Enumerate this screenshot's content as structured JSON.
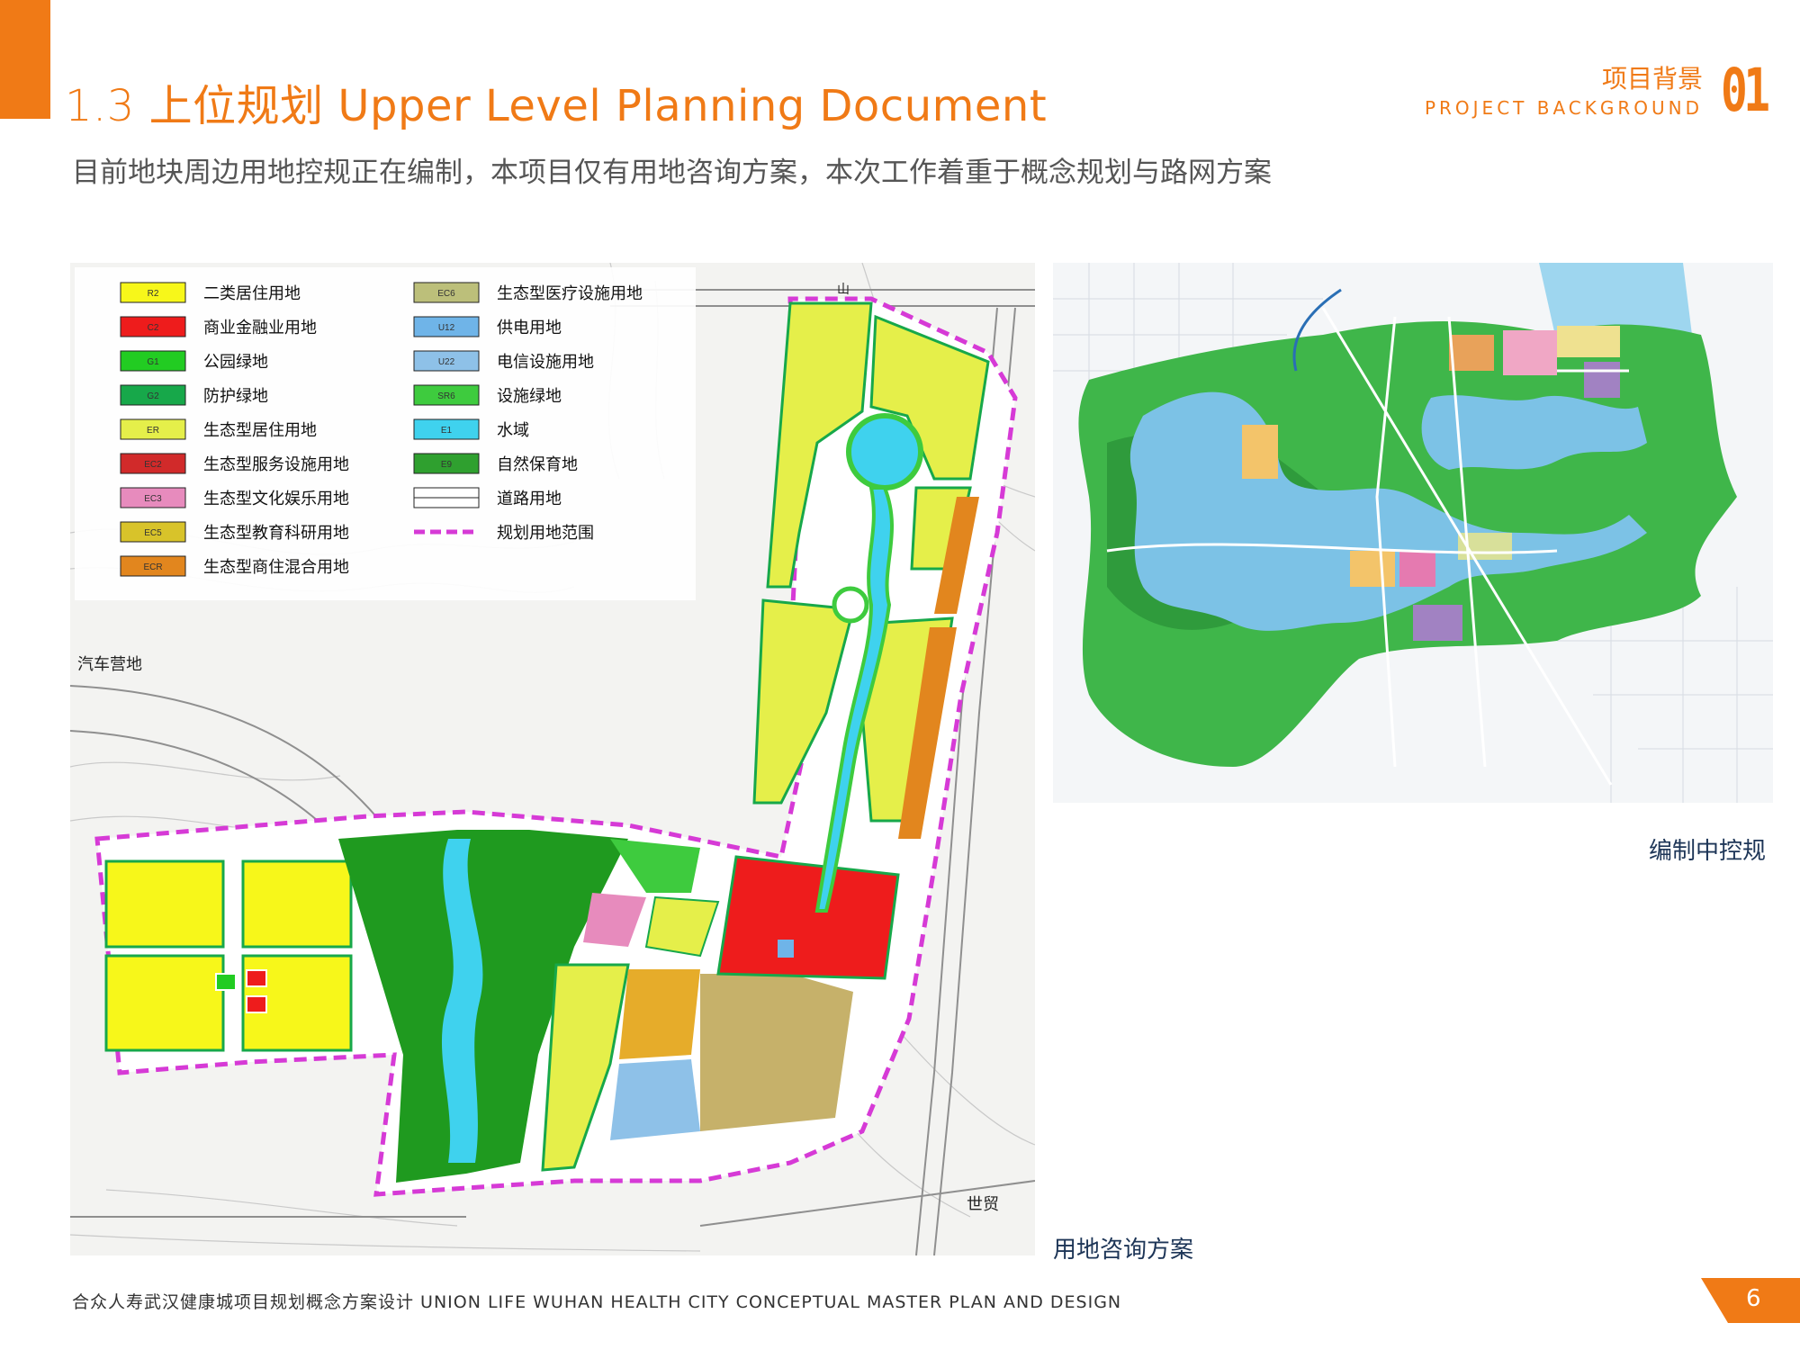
{
  "header": {
    "section_number": "1.3",
    "title_cn": "上位规划",
    "title_en": "Upper Level Planning Document",
    "section_cn": "项目背景",
    "section_en": "PROJECT BACKGROUND",
    "section_num": "01"
  },
  "subtitle": "目前地块周边用地控规正在编制，本项目仅有用地咨询方案，本次工作着重于概念规划与路网方案",
  "legend": {
    "left_column": [
      {
        "code": "R2",
        "label": "二类居住用地",
        "color": "#f7f71a"
      },
      {
        "code": "C2",
        "label": "商业金融业用地",
        "color": "#ee1c1c"
      },
      {
        "code": "G1",
        "label": "公园绿地",
        "color": "#22cc22"
      },
      {
        "code": "G2",
        "label": "防护绿地",
        "color": "#17a84a"
      },
      {
        "code": "ER",
        "label": "生态型居住用地",
        "color": "#e5ef4a"
      },
      {
        "code": "EC2",
        "label": "生态型服务设施用地",
        "color": "#d12a2a"
      },
      {
        "code": "EC3",
        "label": "生态型文化娱乐用地",
        "color": "#e78bbd"
      },
      {
        "code": "EC5",
        "label": "生态型教育科研用地",
        "color": "#d8c32a"
      },
      {
        "code": "ECR",
        "label": "生态型商住混合用地",
        "color": "#e2861e"
      }
    ],
    "right_column": [
      {
        "code": "EC6",
        "label": "生态型医疗设施用地",
        "color": "#bcbf7a"
      },
      {
        "code": "U12",
        "label": "供电用地",
        "color": "#6fb4e8"
      },
      {
        "code": "U22",
        "label": "电信设施用地",
        "color": "#8ec1e8"
      },
      {
        "code": "SR6",
        "label": "设施绿地",
        "color": "#3ecb3e"
      },
      {
        "code": "E1",
        "label": "水域",
        "color": "#3fd2ee"
      },
      {
        "code": "E9",
        "label": "自然保育地",
        "color": "#2fa02f"
      },
      {
        "code": "",
        "label": "道路用地",
        "color": "#ffffff"
      },
      {
        "code": "",
        "label": "规划用地范围",
        "color": "#d63ad6"
      }
    ]
  },
  "map_labels": {
    "camp": "汽车营地",
    "trade": "世贸",
    "mountain": "山"
  },
  "captions": {
    "right": "编制中控规",
    "left": "用地咨询方案"
  },
  "footer": {
    "text": "合众人寿武汉健康城项目规划概念方案设计   UNION LIFE WUHAN HEALTH CITY CONCEPTUAL MASTER PLAN AND DESIGN",
    "page": "6"
  },
  "colors": {
    "accent": "#f07a16",
    "caption": "#1d3557"
  }
}
